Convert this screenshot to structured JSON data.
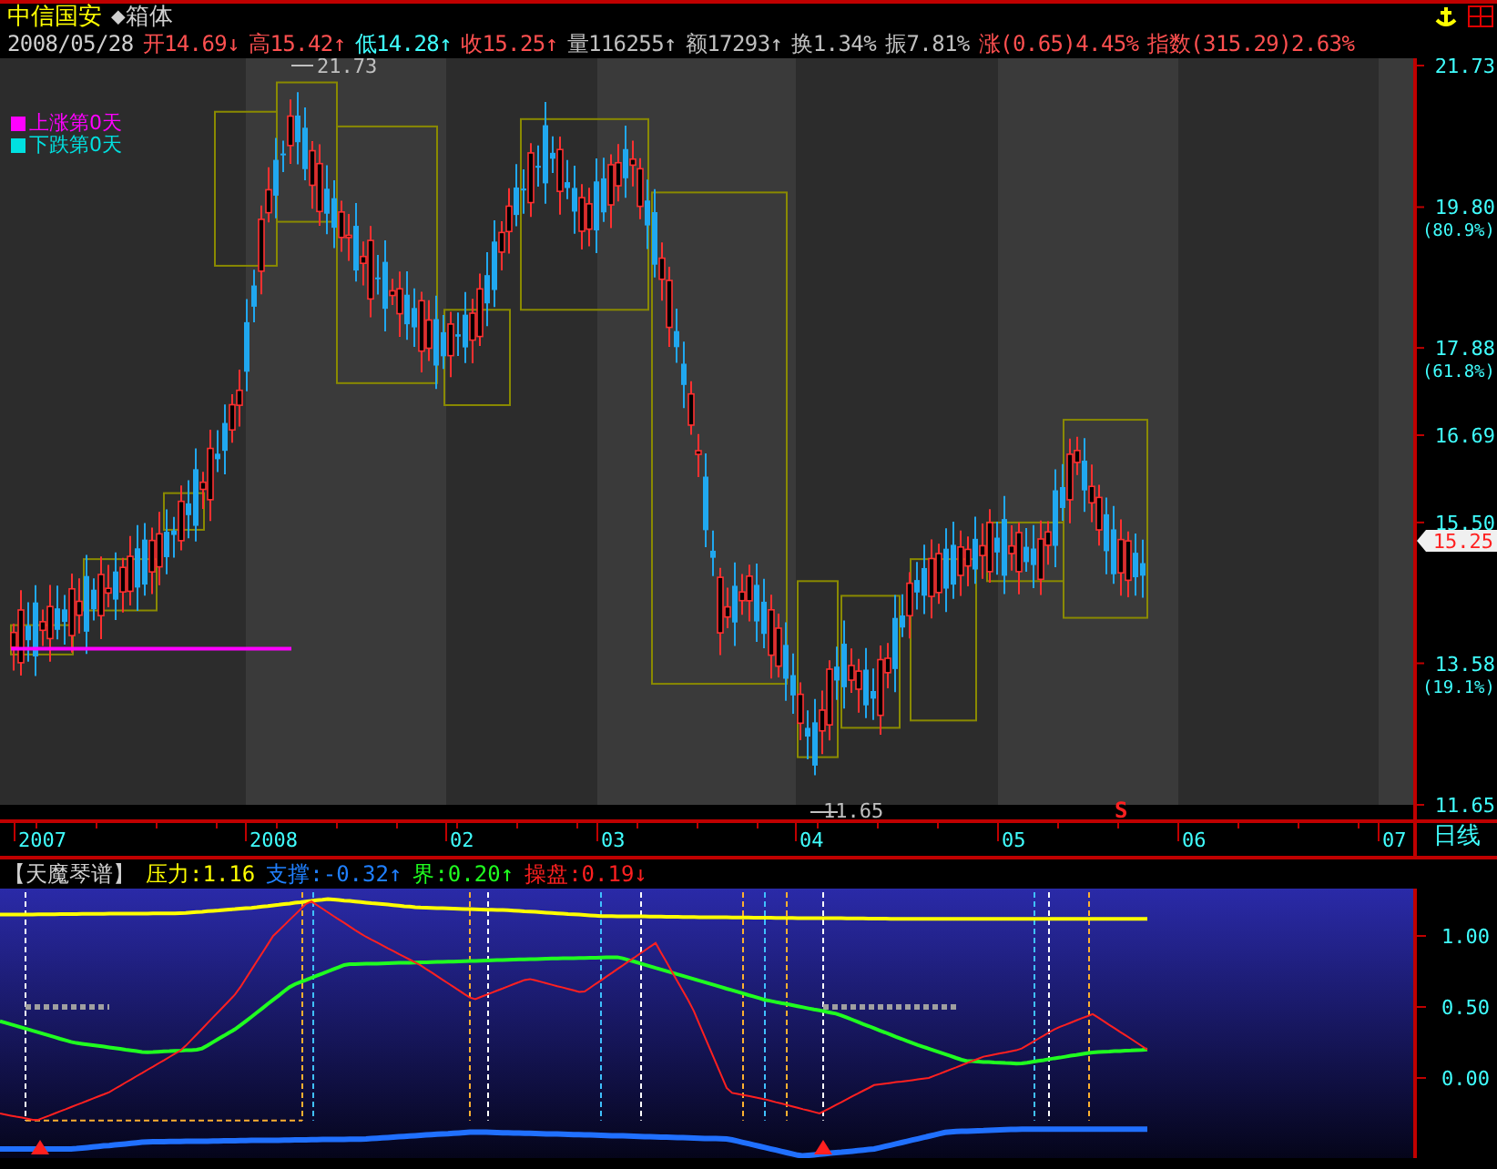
{
  "header": {
    "stock_name": "中信国安",
    "chart_type": "◆箱体",
    "date": "2008/05/28",
    "quotes": [
      {
        "text": "开14.69↓",
        "color": "#ff5050"
      },
      {
        "text": "高15.42↑",
        "color": "#ff5050"
      },
      {
        "text": "低14.28↑",
        "color": "#40ffff"
      },
      {
        "text": "收15.25↑",
        "color": "#ff5050"
      },
      {
        "text": "量116255↑",
        "color": "#c0c0c0"
      },
      {
        "text": "额17293↑",
        "color": "#c0c0c0"
      },
      {
        "text": "换1.34%",
        "color": "#c0c0c0"
      },
      {
        "text": "振7.81%",
        "color": "#c0c0c0"
      },
      {
        "text": "涨(0.65)4.45%",
        "color": "#ff5050"
      },
      {
        "text": "指数(315.29)2.63%",
        "color": "#ff5050"
      }
    ]
  },
  "legend": [
    {
      "label": "上涨第0天",
      "color": "#ff00ff"
    },
    {
      "label": "下跌第0天",
      "color": "#00e0e0"
    }
  ],
  "price_chart": {
    "high_label": "21.73",
    "low_label": "11.65",
    "signal": "S",
    "current_price": "15.25",
    "axis_ticks": [
      {
        "value": "21.73"
      },
      {
        "value": "19.80",
        "pct": "(80.9%)"
      },
      {
        "value": "17.88",
        "pct": "(61.8%)"
      },
      {
        "value": "16.69"
      },
      {
        "value": "15.50"
      },
      {
        "value": "13.58",
        "pct": "(19.1%)"
      },
      {
        "value": "11.65"
      }
    ]
  },
  "time_axis": {
    "labels": [
      "2007",
      "2008",
      "02",
      "03",
      "04",
      "05",
      "06",
      "07"
    ],
    "period": "日线"
  },
  "indicator": {
    "title": "【天魔琴谱】",
    "readouts": [
      {
        "text": "压力:1.16",
        "kind": "pressure"
      },
      {
        "text": "支撑:-0.32↑",
        "kind": "support"
      },
      {
        "text": "界:0.20↑",
        "kind": "boundary"
      },
      {
        "text": "操盘:0.19↓",
        "kind": "trade"
      }
    ],
    "axis_ticks": [
      "1.00",
      "0.50",
      "0.00"
    ]
  }
}
